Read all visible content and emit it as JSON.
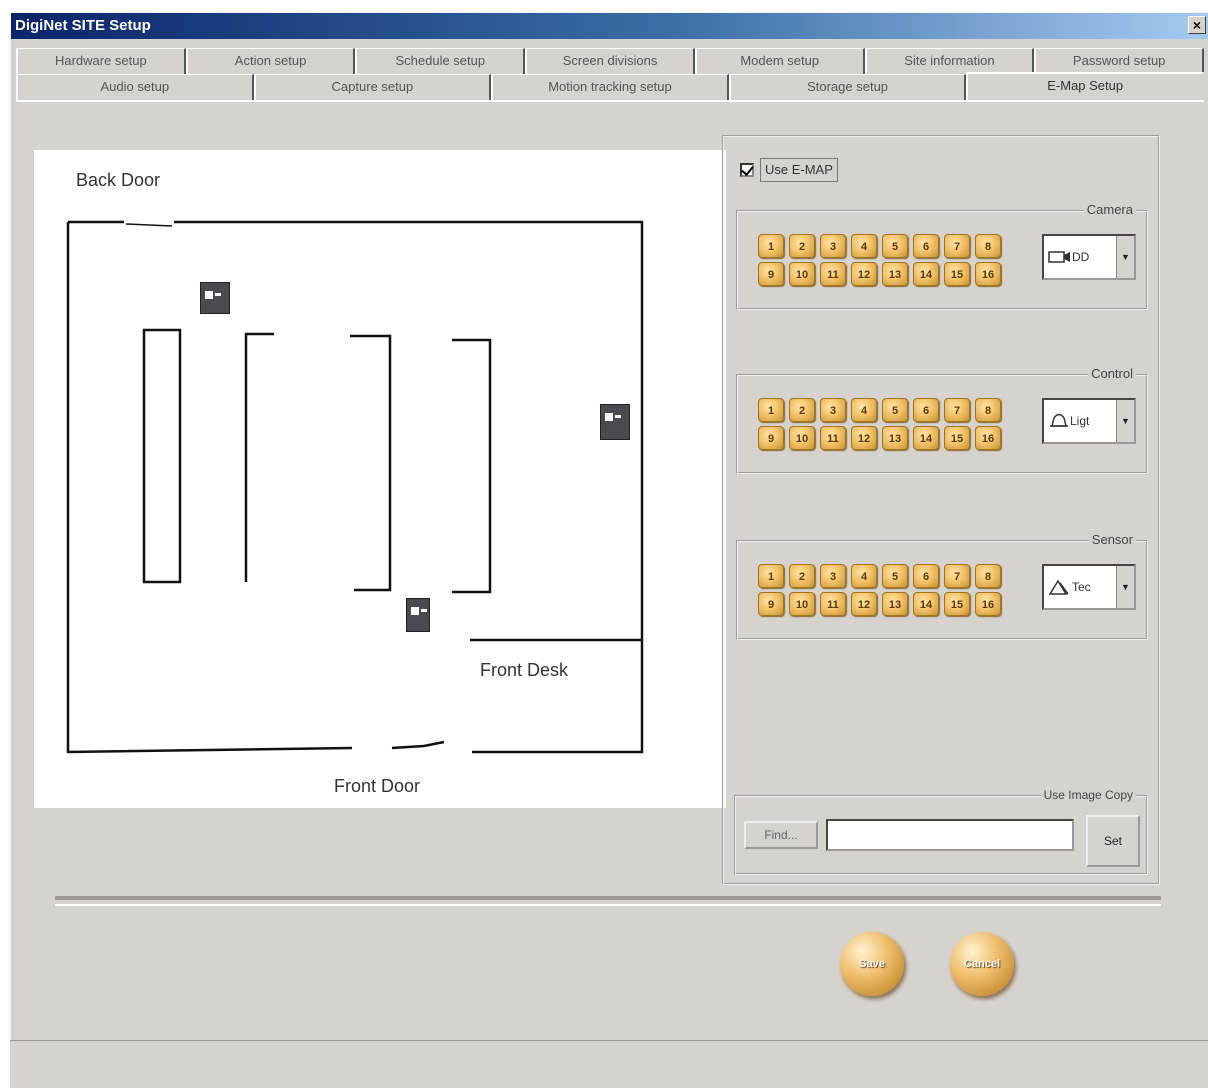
{
  "window": {
    "title": "DigiNet SITE Setup",
    "close_label": "×"
  },
  "tabs_row1": [
    "Hardware setup",
    "Action setup",
    "Schedule setup",
    "Screen divisions",
    "Modem setup",
    "Site information",
    "Password setup"
  ],
  "tabs_row2": [
    "Audio setup",
    "Capture setup",
    "Motion tracking setup",
    "Storage setup",
    "E-Map Setup"
  ],
  "active_tab": "E-Map Setup",
  "map": {
    "back_door_label": "Back Door",
    "front_desk_label": "Front Desk",
    "front_door_label": "Front Door"
  },
  "use_emap": {
    "label": "Use E-MAP",
    "checked": true
  },
  "camera_group": {
    "title": "Camera",
    "buttons": [
      "1",
      "2",
      "3",
      "4",
      "5",
      "6",
      "7",
      "8",
      "9",
      "10",
      "11",
      "12",
      "13",
      "14",
      "15",
      "16"
    ],
    "combo_value": "DD"
  },
  "control_group": {
    "title": "Control",
    "buttons": [
      "1",
      "2",
      "3",
      "4",
      "5",
      "6",
      "7",
      "8",
      "9",
      "10",
      "11",
      "12",
      "13",
      "14",
      "15",
      "16"
    ],
    "combo_value": "Ligt"
  },
  "sensor_group": {
    "title": "Sensor",
    "buttons": [
      "1",
      "2",
      "3",
      "4",
      "5",
      "6",
      "7",
      "8",
      "9",
      "10",
      "11",
      "12",
      "13",
      "14",
      "15",
      "16"
    ],
    "combo_value": "Tec"
  },
  "image_copy": {
    "title": "Use Image Copy",
    "find_label": "Find...",
    "path_value": "",
    "set_label": "Set"
  },
  "actions": {
    "save_label": "Save",
    "cancel_label": "Cancel"
  },
  "colors": {
    "face": "#d6d3ce",
    "title_start": "#0a246a",
    "title_end": "#a6caf0",
    "button_gold": "#f3c36b"
  },
  "icons": {
    "camera": "camera-icon",
    "control": "bell-icon",
    "sensor": "sensor-icon"
  }
}
